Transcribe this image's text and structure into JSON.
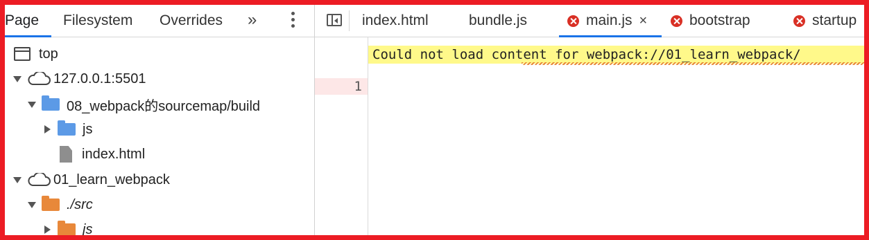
{
  "left_panel": {
    "tabs": [
      {
        "label": "Page"
      },
      {
        "label": "Filesystem"
      },
      {
        "label": "Overrides"
      }
    ],
    "more_label": "»",
    "tree": [
      {
        "label": "top",
        "icon": "frame-icon"
      },
      {
        "label": "127.0.0.1:5501",
        "icon": "cloud-icon"
      },
      {
        "label": "08_webpack的sourcemap/build",
        "icon": "folder-icon"
      },
      {
        "label": "js",
        "icon": "folder-icon"
      },
      {
        "label": "index.html",
        "icon": "file-icon"
      },
      {
        "label": "01_learn_webpack",
        "icon": "cloud-icon"
      },
      {
        "label": "./src",
        "icon": "folder-icon"
      },
      {
        "label": "js",
        "icon": "folder-icon"
      }
    ]
  },
  "editor": {
    "tabs": [
      {
        "label": "index.html",
        "error": false
      },
      {
        "label": "bundle.js",
        "error": false
      },
      {
        "label": "main.js",
        "error": true,
        "active": true
      },
      {
        "label": "bootstrap",
        "error": true
      },
      {
        "label": "startup",
        "error": true
      }
    ],
    "close_label": "×",
    "line_number": "1",
    "line_text": "Could not load content for webpack://01_learn_webpack/"
  },
  "colors": {
    "frame_border": "#ec1c24",
    "active_tab_underline": "#1a73e8",
    "error_icon": "#d93025",
    "highlight_line": "#fff98a",
    "blue_folder": "#5c9ae6",
    "orange_folder": "#e8883a"
  }
}
